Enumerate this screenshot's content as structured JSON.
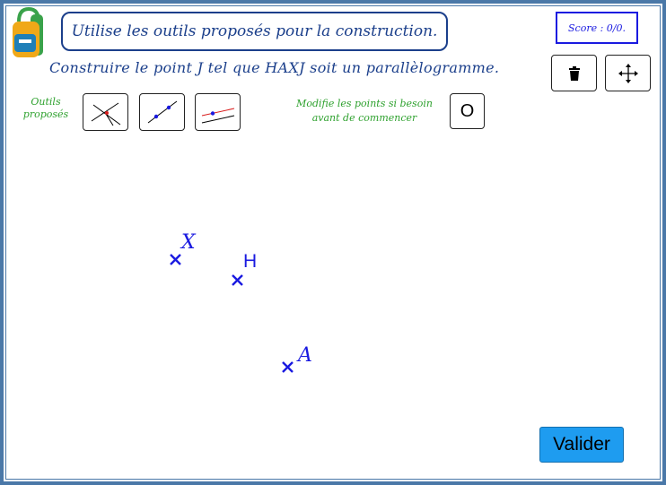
{
  "instruction": "Utilise les outils proposés pour la construction.",
  "score": "Score : 0/0.",
  "task": "Construire le point J tel que HAXJ soit un parallèlogramme.",
  "tools": {
    "label_line1": "Outils",
    "label_line2": "proposés",
    "items": [
      "compass-tool-icon",
      "line-through-two-points-icon",
      "parallel-line-icon"
    ]
  },
  "modify": {
    "line1": "Modifie les points si besoin",
    "line2": "avant de commencer",
    "button_label": "O"
  },
  "toolbar": {
    "delete_icon": "trash-icon",
    "move_icon": "move-arrows-icon"
  },
  "points": [
    {
      "label": "X"
    },
    {
      "label": "H"
    },
    {
      "label": "A"
    }
  ],
  "valider_label": "Valider",
  "colors": {
    "frame": "#4a78a8",
    "text_blue": "#1b3f8b",
    "point_blue": "#1a1ae0",
    "green": "#2ea12e",
    "valider_bg": "#1e9cf0"
  }
}
